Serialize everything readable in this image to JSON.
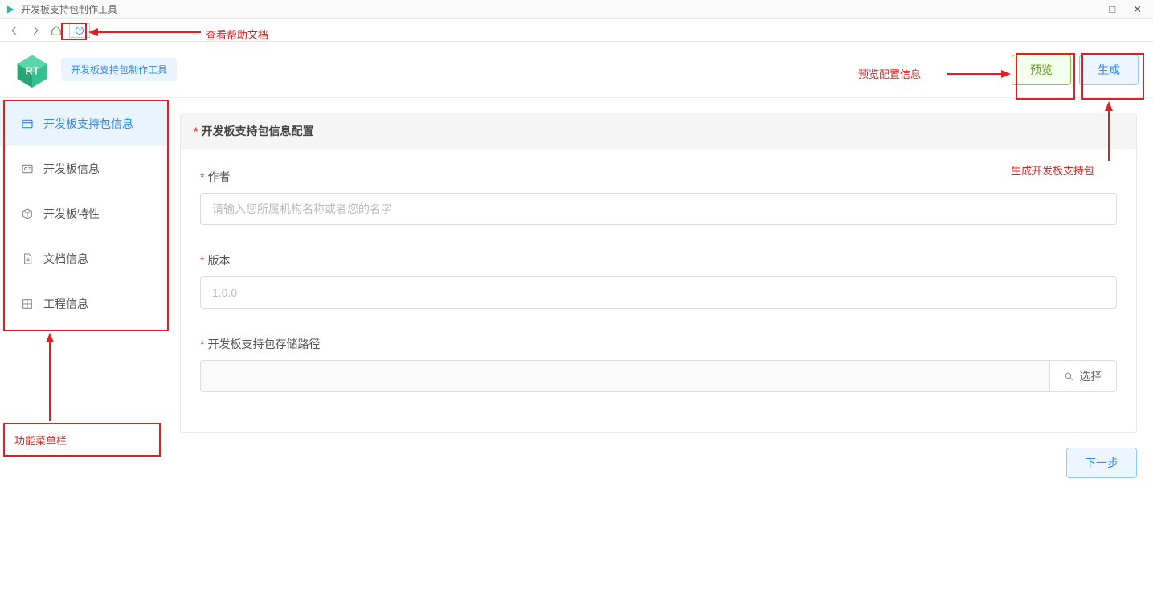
{
  "window": {
    "title": "开发板支持包制作工具"
  },
  "header": {
    "badge": "开发板支持包制作工具",
    "preview_label": "预览",
    "generate_label": "生成"
  },
  "sidebar": {
    "items": [
      {
        "label": "开发板支持包信息",
        "active": true
      },
      {
        "label": "开发板信息",
        "active": false
      },
      {
        "label": "开发板特性",
        "active": false
      },
      {
        "label": "文档信息",
        "active": false
      },
      {
        "label": "工程信息",
        "active": false
      }
    ]
  },
  "panel": {
    "title": "开发板支持包信息配置",
    "fields": {
      "author": {
        "label": "作者",
        "placeholder": "请输入您所属机构名称或者您的名字",
        "value": ""
      },
      "version": {
        "label": "版本",
        "placeholder": "1.0.0",
        "value": ""
      },
      "path": {
        "label": "开发板支持包存储路径",
        "value": "",
        "choose_label": "选择"
      }
    }
  },
  "actions": {
    "next_label": "下一步"
  },
  "annotations": {
    "help_doc": "查看帮助文档",
    "preview_info": "预览配置信息",
    "generate_pkg": "生成开发板支持包",
    "menu_bar": "功能菜单栏"
  }
}
